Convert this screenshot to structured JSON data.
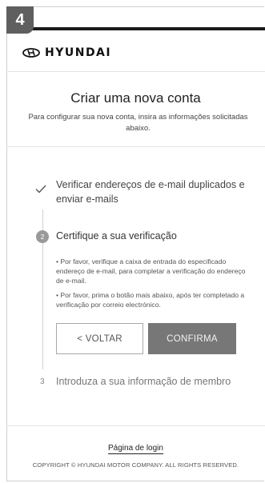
{
  "step_badge": "4",
  "brand": {
    "name": "HYUNDAI",
    "logo_icon": "hyundai-logo-icon"
  },
  "page": {
    "title": "Criar uma nova conta",
    "subtitle": "Para configurar sua nova conta, insira as informações solicitadas abaixo."
  },
  "steps": [
    {
      "number": "1",
      "status": "completed",
      "icon": "checkmark-icon",
      "label": "Verificar endereços de e-mail duplicados e enviar e-mails"
    },
    {
      "number": "2",
      "status": "active",
      "label": "Certifique a sua verificação",
      "bullets": [
        "• Por favor, verifique a caixa de entrada do especificado endereço de e-mail, para completar a verificação do endereço de e-mail.",
        "• Por favor, prima o botão mais abaixo, após ter completado a verificação por correio electrónico."
      ],
      "buttons": {
        "back_label": "< VOLTAR",
        "confirm_label": "CONFIRMA"
      }
    },
    {
      "number": "3",
      "status": "pending",
      "label": "Introduza a sua informação de membro"
    }
  ],
  "footer": {
    "login_link": "Página de login",
    "copyright": "COPYRIGHT © HYUNDAI MOTOR COMPANY. ALL RIGHTS RESERVED."
  },
  "colors": {
    "confirm_button": "#777777",
    "topbar": "#1a1a1a",
    "badge": "#5f5f5f"
  }
}
